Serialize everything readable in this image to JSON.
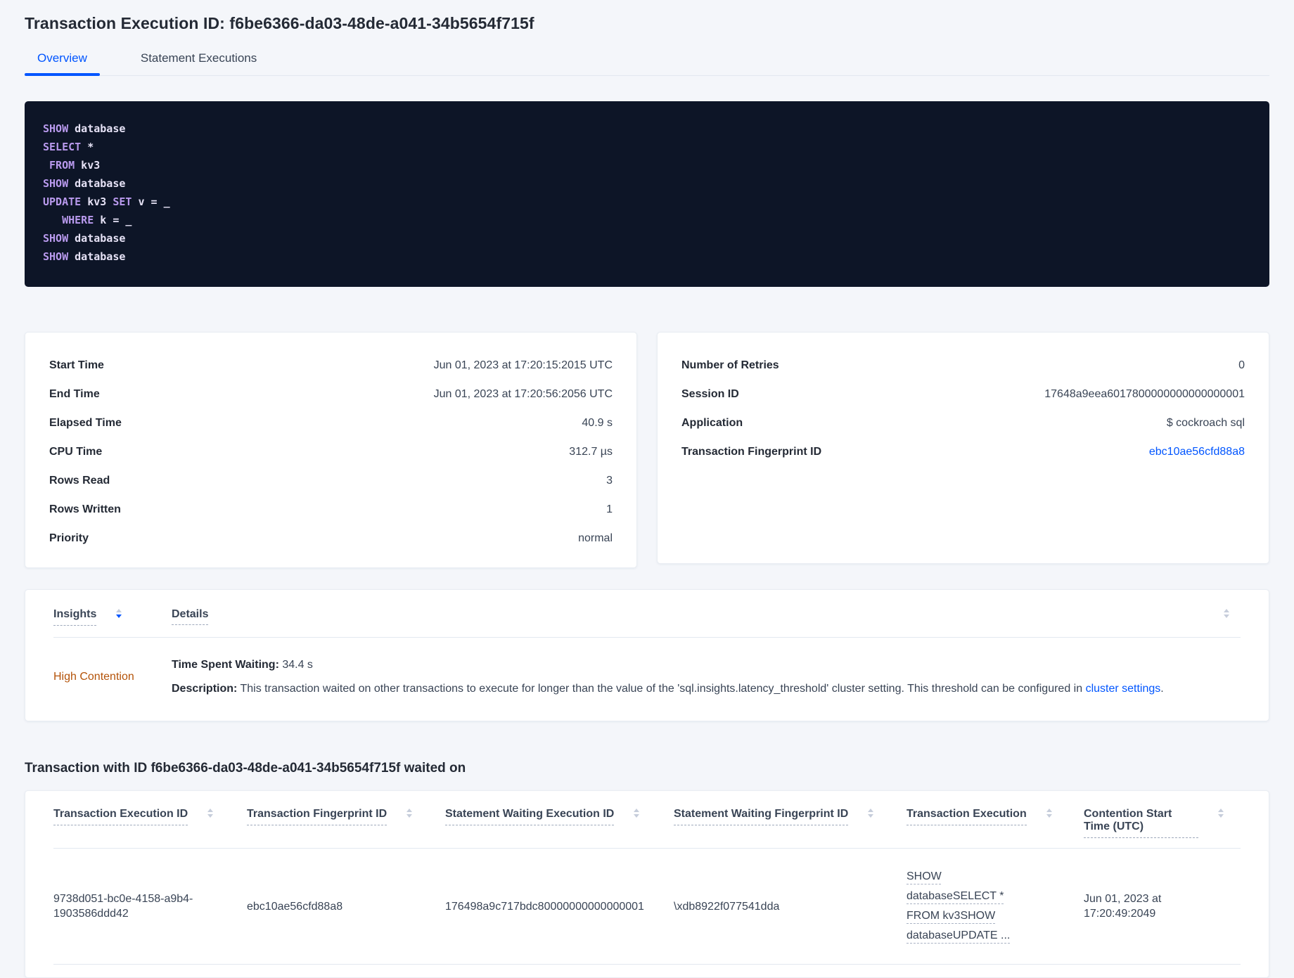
{
  "page": {
    "title": "Transaction Execution ID: f6be6366-da03-48de-a041-34b5654f715f"
  },
  "tabs": [
    {
      "label": "Overview"
    },
    {
      "label": "Statement Executions"
    }
  ],
  "sql_box": {
    "lines": [
      [
        [
          "kw",
          "SHOW"
        ],
        [
          "pl",
          " database"
        ]
      ],
      [
        [
          "kw",
          "SELECT"
        ],
        [
          "pl",
          " *"
        ]
      ],
      [
        [
          "pl",
          " "
        ],
        [
          "kw",
          "FROM"
        ],
        [
          "pl",
          " kv3"
        ]
      ],
      [
        [
          "kw",
          "SHOW"
        ],
        [
          "pl",
          " database"
        ]
      ],
      [
        [
          "kw",
          "UPDATE"
        ],
        [
          "pl",
          " kv3 "
        ],
        [
          "kw",
          "SET"
        ],
        [
          "pl",
          " v = _"
        ]
      ],
      [
        [
          "pl",
          "   "
        ],
        [
          "kw",
          "WHERE"
        ],
        [
          "pl",
          " k = _"
        ]
      ],
      [
        [
          "kw",
          "SHOW"
        ],
        [
          "pl",
          " database"
        ]
      ],
      [
        [
          "kw",
          "SHOW"
        ],
        [
          "pl",
          " database"
        ]
      ]
    ]
  },
  "stats_left": {
    "rows": [
      {
        "label": "Start Time",
        "value": "Jun 01, 2023 at 17:20:15:2015 UTC"
      },
      {
        "label": "End Time",
        "value": "Jun 01, 2023 at 17:20:56:2056 UTC"
      },
      {
        "label": "Elapsed Time",
        "value": "40.9 s"
      },
      {
        "label": "CPU Time",
        "value": "312.7 µs"
      },
      {
        "label": "Rows Read",
        "value": "3"
      },
      {
        "label": "Rows Written",
        "value": "1"
      },
      {
        "label": "Priority",
        "value": "normal"
      }
    ]
  },
  "stats_right": {
    "rows": [
      {
        "label": "Number of Retries",
        "value": "0"
      },
      {
        "label": "Session ID",
        "value": "17648a9eea6017800000000000000001"
      },
      {
        "label": "Application",
        "value": "$ cockroach sql"
      },
      {
        "label": "Transaction Fingerprint ID",
        "value": "ebc10ae56cfd88a8",
        "link": true
      }
    ]
  },
  "insights_table": {
    "columns": [
      {
        "label": "Insights"
      },
      {
        "label": "Details"
      }
    ],
    "row": {
      "insight": "High Contention",
      "waiting_label": "Time Spent Waiting:",
      "waiting_value": " 34.4 s",
      "description_label": "Description:",
      "description_text": " This transaction waited on other transactions to execute for longer than the value of the 'sql.insights.latency_threshold' cluster setting. This threshold can be configured in ",
      "description_link": "cluster settings",
      "description_suffix": "."
    }
  },
  "waited_on": {
    "heading": "Transaction with ID f6be6366-da03-48de-a041-34b5654f715f waited on",
    "columns": [
      "Transaction Execution ID",
      "Transaction Fingerprint ID",
      "Statement Waiting Execution ID",
      "Statement Waiting Fingerprint ID",
      "Transaction Execution",
      "Contention Start Time (UTC)"
    ],
    "rows": [
      {
        "transaction_execution_id": "9738d051-bc0e-4158-a9b4-1903586ddd42",
        "transaction_fingerprint_id": "ebc10ae56cfd88a8",
        "statement_waiting_execution_id": "176498a9c717bdc80000000000000001",
        "statement_waiting_fingerprint_id": "\\xdb8922f077541dda",
        "transaction_execution": "SHOW databaseSELECT * FROM kv3SHOW databaseUPDATE ...",
        "contention_start_time": "Jun 01, 2023 at 17:20:49:2049"
      }
    ]
  },
  "colors": {
    "accent_blue": "#0055ff",
    "warning_orange": "#b45309",
    "code_background": "#0d1527",
    "code_keyword": "#b99aee",
    "code_plain": "#e6e2f6"
  }
}
